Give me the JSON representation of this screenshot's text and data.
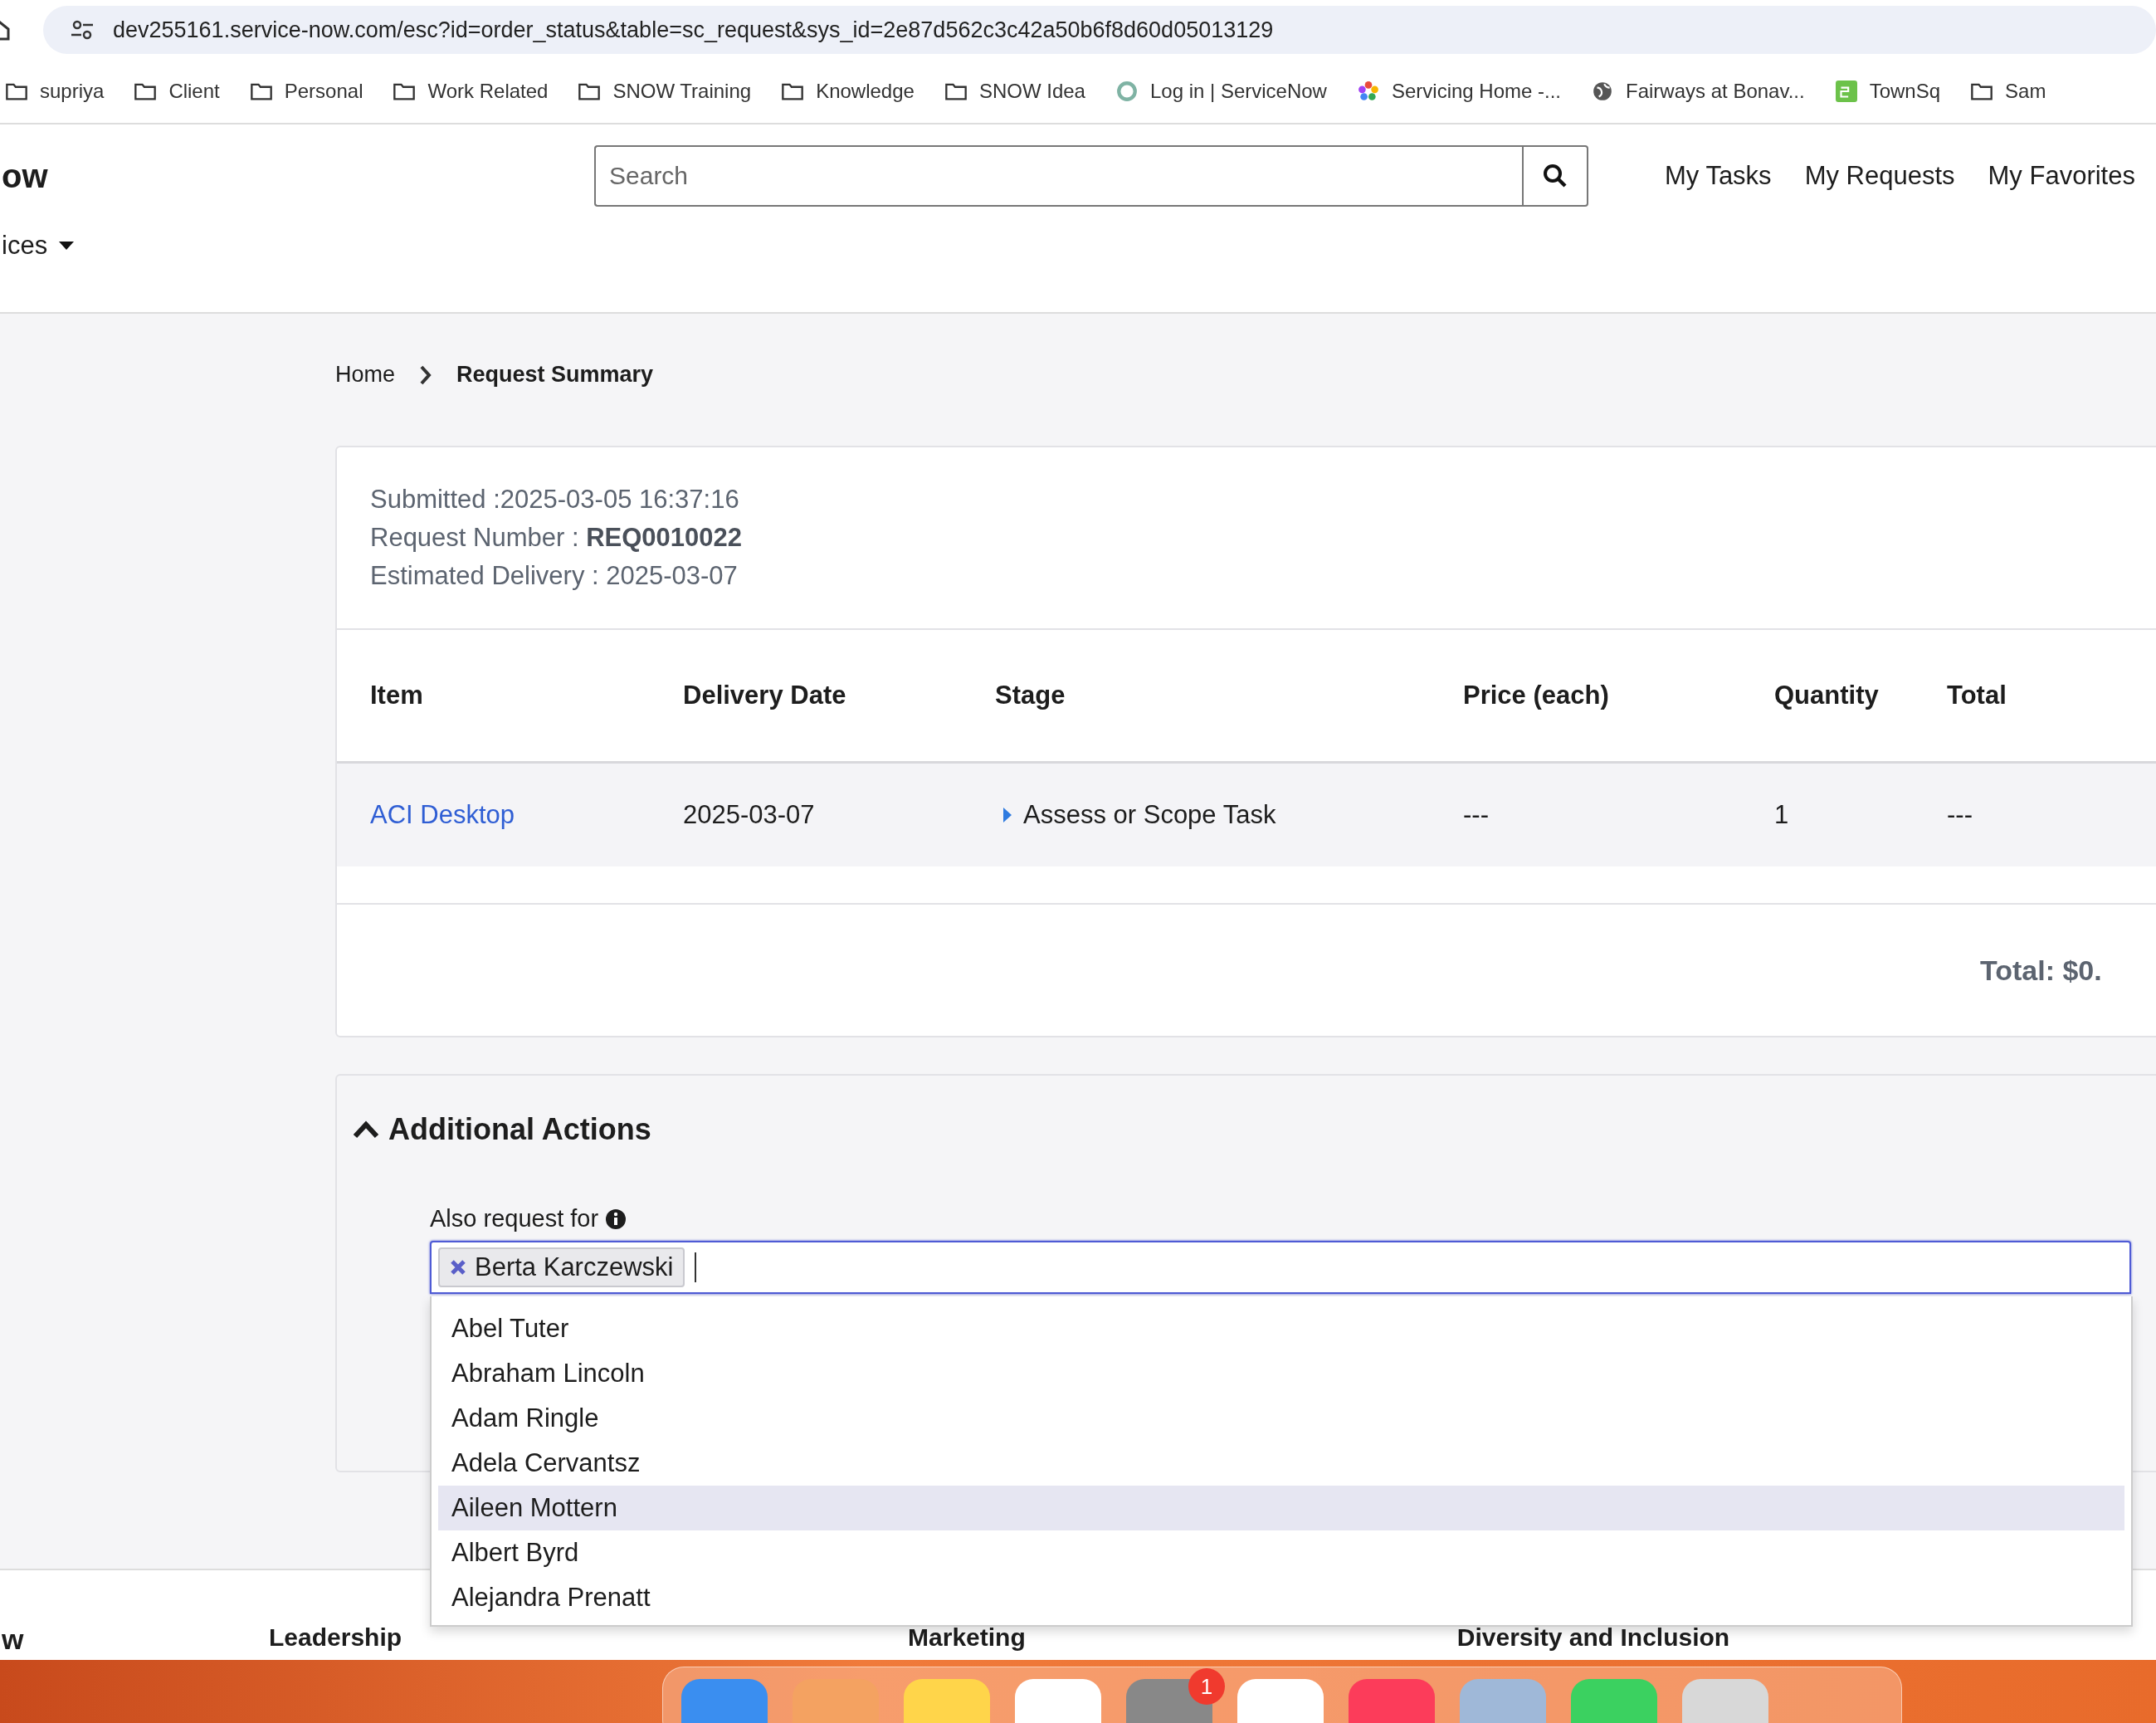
{
  "browser": {
    "url": "dev255161.service-now.com/esc?id=order_status&table=sc_request&sys_id=2e87d562c3c42a50b6f8d60d05013129",
    "bookmarks": [
      {
        "label": "supriya",
        "kind": "folder"
      },
      {
        "label": "Client",
        "kind": "folder"
      },
      {
        "label": "Personal",
        "kind": "folder"
      },
      {
        "label": "Work Related",
        "kind": "folder"
      },
      {
        "label": "SNOW Training",
        "kind": "folder"
      },
      {
        "label": "Knowledge",
        "kind": "folder"
      },
      {
        "label": "SNOW Idea",
        "kind": "folder"
      },
      {
        "label": "Log in | ServiceNow",
        "kind": "ring"
      },
      {
        "label": "Servicing Home -...",
        "kind": "pinwheel"
      },
      {
        "label": "Fairways at Bonav...",
        "kind": "globe"
      },
      {
        "label": "TownSq",
        "kind": "tile"
      },
      {
        "label": "Sam",
        "kind": "folder"
      }
    ]
  },
  "header": {
    "logo_text": "ow",
    "search": {
      "placeholder": "Search"
    },
    "nav": [
      "My Tasks",
      "My Requests",
      "My Favorites"
    ],
    "menu": "ices"
  },
  "breadcrumb": [
    "Home",
    "Request Summary"
  ],
  "summary": {
    "submitted": "Submitted :2025-03-05 16:37:16",
    "request_number_label": "Request Number : ",
    "request_number": "REQ0010022",
    "estimated_delivery": "Estimated Delivery : 2025-03-07"
  },
  "table": {
    "columns": [
      "Item",
      "Delivery Date",
      "Stage",
      "Price (each)",
      "Quantity",
      "Total"
    ],
    "rows": [
      {
        "item": "ACI Desktop",
        "delivery_date": "2025-03-07",
        "stage": "Assess or Scope Task",
        "price": "---",
        "quantity": "1",
        "total": "---"
      }
    ],
    "total": "Total: $0."
  },
  "additional_actions": {
    "title": "Additional Actions",
    "expanded": true,
    "field_label": "Also request for",
    "tags": [
      "Berta Karczewski"
    ],
    "options": [
      {
        "label": "Abel Tuter",
        "selected": false
      },
      {
        "label": "Abraham Lincoln",
        "selected": false
      },
      {
        "label": "Adam Ringle",
        "selected": false
      },
      {
        "label": "Adela Cervantsz",
        "selected": false
      },
      {
        "label": "Aileen Mottern",
        "selected": true
      },
      {
        "label": "Albert Byrd",
        "selected": false
      },
      {
        "label": "Alejandra Prenatt",
        "selected": false
      }
    ]
  },
  "footer": {
    "logo_text": "w",
    "links": [
      "Leadership",
      "Marketing",
      "Diversity and Inclusion"
    ]
  },
  "dock": {
    "badge": "1"
  }
}
